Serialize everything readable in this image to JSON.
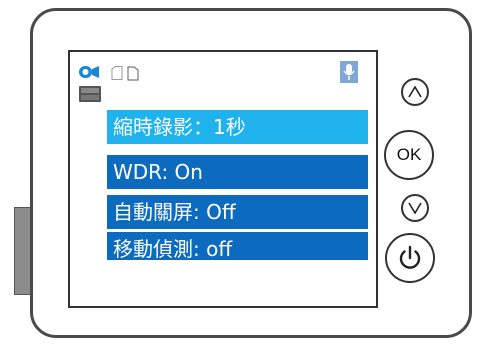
{
  "device": {
    "name": "action-camera"
  },
  "screen": {
    "status_bar": {
      "icons": [
        "video-camera-icon",
        "sd-card-icon",
        "battery-icon",
        "microphone-icon"
      ],
      "resolution_badge_icon": "resolution-1080p-icon"
    },
    "menu": [
      {
        "label": "縮時錄影：1秒",
        "state": "selected"
      },
      {
        "label": "WDR: On",
        "state": "normal"
      },
      {
        "label": "自動關屏: Off",
        "state": "normal"
      },
      {
        "label": "移動偵測:  off",
        "state": "normal"
      }
    ]
  },
  "buttons": {
    "up_icon": "chevron-up-icon",
    "ok_label": "OK",
    "down_icon": "chevron-down-icon",
    "power_icon": "power-icon"
  },
  "colors": {
    "selected_item": "#1fb2ec",
    "menu_item": "#0d6bbf",
    "camera_icon": "#1a87d4",
    "mic_icon": "#4a90d9"
  }
}
